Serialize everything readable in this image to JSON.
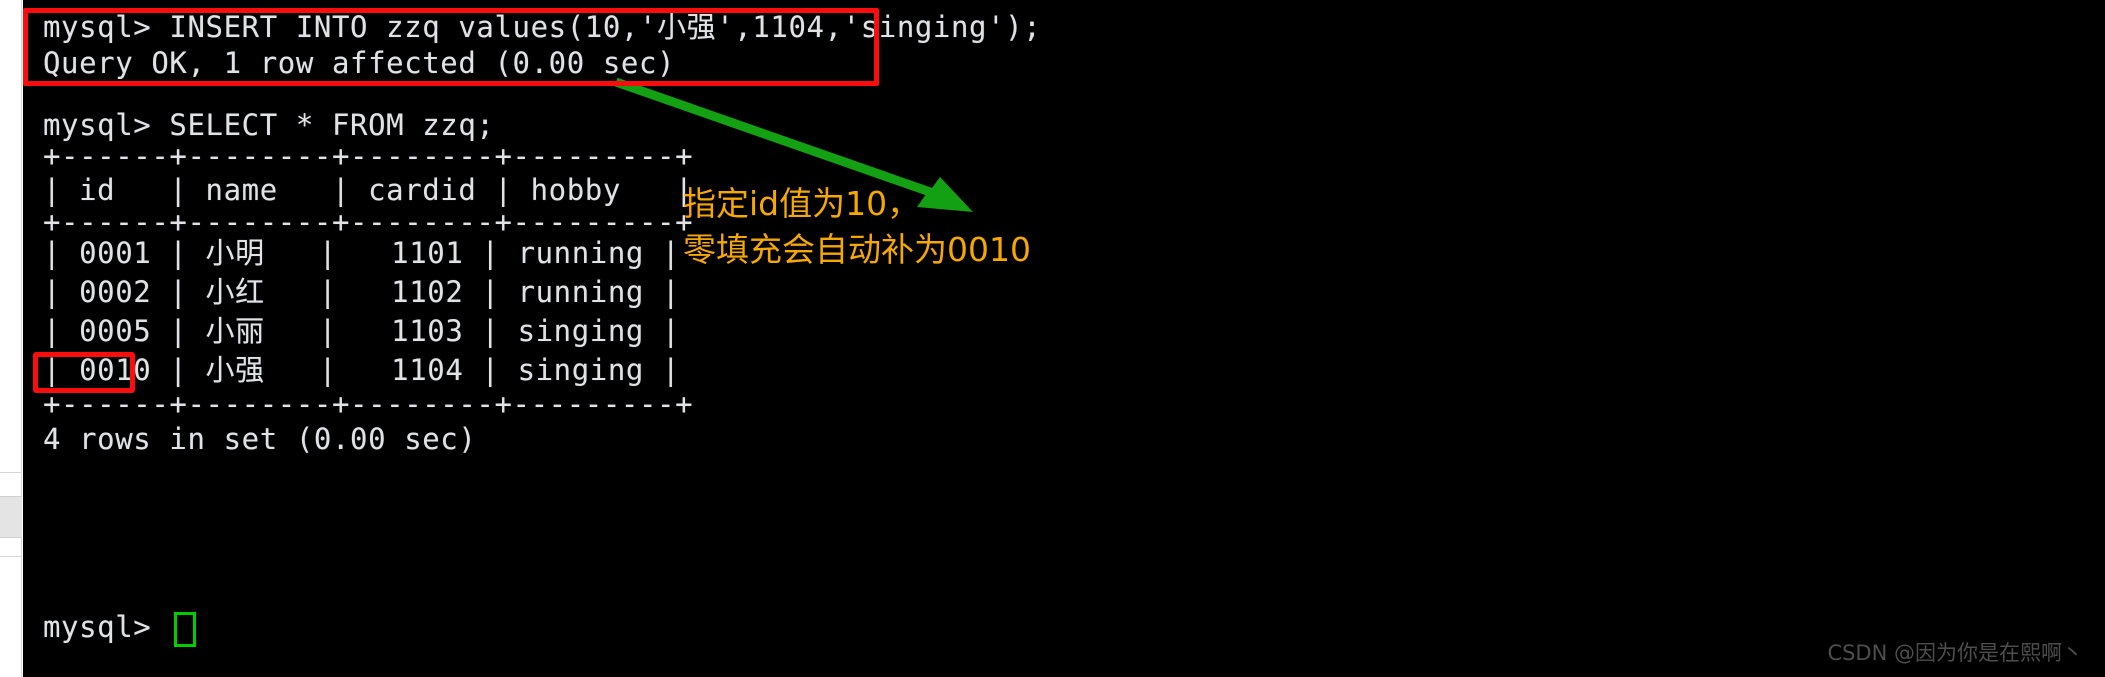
{
  "terminal": {
    "prompt": "mysql>",
    "lines": [
      {
        "id": "insert-cmd",
        "text": "mysql> INSERT INTO zzq values(10,'小强',1104,'singing');"
      },
      {
        "id": "insert-result",
        "text": "Query OK, 1 row affected (0.00 sec)"
      },
      {
        "id": "select-cmd",
        "text": "mysql> SELECT * FROM zzq;"
      },
      {
        "id": "border-top",
        "text": "+------+--------+--------+---------+"
      },
      {
        "id": "header-row",
        "text": "| id   | name   | cardid | hobby   |"
      },
      {
        "id": "border-mid",
        "text": "+------+--------+--------+---------+"
      },
      {
        "id": "data-row-1",
        "text": "| 0001 | 小明   |   1101 | running |"
      },
      {
        "id": "data-row-2",
        "text": "| 0002 | 小红   |   1102 | running |"
      },
      {
        "id": "data-row-3",
        "text": "| 0005 | 小丽   |   1103 | singing |"
      },
      {
        "id": "data-row-4",
        "text": "| 0010 | 小强   |   1104 | singing |"
      },
      {
        "id": "border-bot",
        "text": "+------+--------+--------+---------+"
      },
      {
        "id": "rows-count",
        "text": "4 rows in set (0.00 sec)"
      },
      {
        "id": "final-prompt",
        "text": "mysql>"
      }
    ],
    "result_table": {
      "columns": [
        "id",
        "name",
        "cardid",
        "hobby"
      ],
      "rows": [
        [
          "0001",
          "小明",
          "1101",
          "running"
        ],
        [
          "0002",
          "小红",
          "1102",
          "running"
        ],
        [
          "0005",
          "小丽",
          "1103",
          "singing"
        ],
        [
          "0010",
          "小强",
          "1104",
          "singing"
        ]
      ],
      "footer": "4 rows in set (0.00 sec)"
    }
  },
  "annotations": {
    "note_line1": "指定id值为10，",
    "note_line2": "零填充会自动补为0010",
    "note_color": "#f5a800",
    "arrow_color": "#13a013",
    "highlight_color": "#fb0d0d",
    "cursor_color": "#00cc00"
  },
  "watermark": {
    "text": "CSDN @因为你是在熙啊丶"
  }
}
